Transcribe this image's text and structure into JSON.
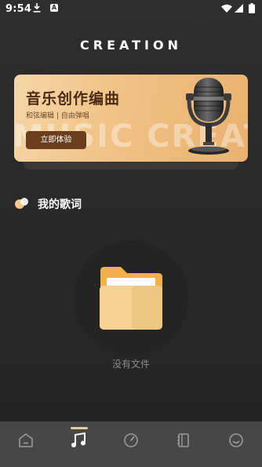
{
  "status_bar": {
    "time": "9:54"
  },
  "header": {
    "title": "CREATION"
  },
  "banner": {
    "title": "音乐创作编曲",
    "subtitle": "和弦编辑 | 自由弹唱",
    "button_label": "立即体验",
    "background_text": "MUSIC CREATION"
  },
  "section": {
    "title": "我的歌词"
  },
  "empty_state": {
    "text": "没有文件"
  },
  "bottom_nav": {
    "items": [
      {
        "icon": "home-icon",
        "active": false
      },
      {
        "icon": "music-note-icon",
        "active": true
      },
      {
        "icon": "compass-icon",
        "active": false
      },
      {
        "icon": "notebook-icon",
        "active": false
      },
      {
        "icon": "smile-icon",
        "active": false
      }
    ]
  },
  "colors": {
    "background": "#2b2b2b",
    "banner_gradient_start": "#f5d6a6",
    "banner_gradient_end": "#e9b270",
    "banner_button": "#6b3f1d",
    "accent": "#f3c88a",
    "nav_bar": "#474747"
  }
}
